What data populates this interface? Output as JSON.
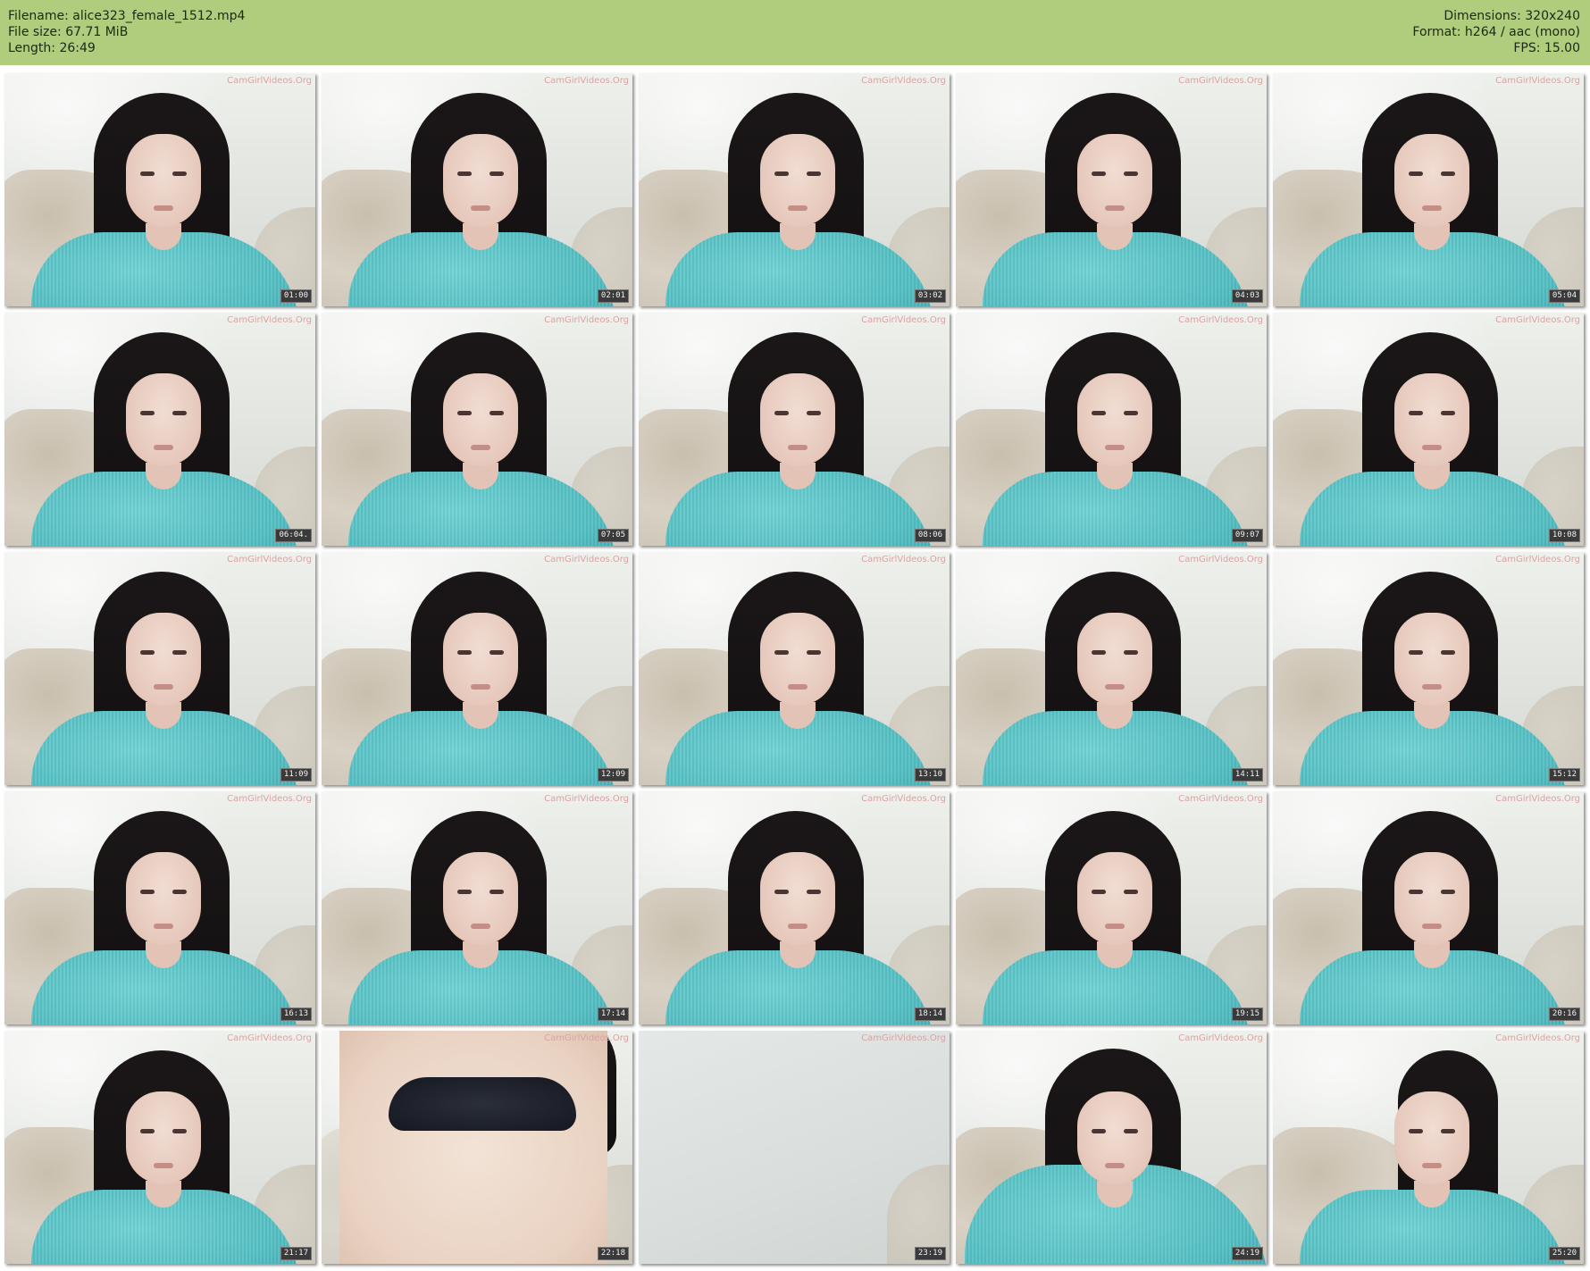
{
  "header": {
    "filename_label": "Filename: alice323_female_1512.mp4",
    "filesize_label": "File size: 67.71 MiB",
    "length_label": "Length: 26:49",
    "dimensions_label": "Dimensions: 320x240",
    "format_label": "Format: h264 / aac (mono)",
    "fps_label": "FPS: 15.00",
    "background_color": "#afcd7c"
  },
  "watermark_text": "CamGirlVideos.Org",
  "thumbnails": [
    {
      "timestamp": "01:00",
      "variant": "default"
    },
    {
      "timestamp": "02:01",
      "variant": "default"
    },
    {
      "timestamp": "03:02",
      "variant": "default"
    },
    {
      "timestamp": "04:03",
      "variant": "default"
    },
    {
      "timestamp": "05:04",
      "variant": "default"
    },
    {
      "timestamp": "06:04.",
      "variant": "default"
    },
    {
      "timestamp": "07:05",
      "variant": "default"
    },
    {
      "timestamp": "08:06",
      "variant": "default"
    },
    {
      "timestamp": "09:07",
      "variant": "default"
    },
    {
      "timestamp": "10:08",
      "variant": "default"
    },
    {
      "timestamp": "11:09",
      "variant": "default"
    },
    {
      "timestamp": "12:09",
      "variant": "default"
    },
    {
      "timestamp": "13:10",
      "variant": "default"
    },
    {
      "timestamp": "14:11",
      "variant": "default"
    },
    {
      "timestamp": "15:12",
      "variant": "default"
    },
    {
      "timestamp": "16:13",
      "variant": "default"
    },
    {
      "timestamp": "17:14",
      "variant": "default"
    },
    {
      "timestamp": "18:14",
      "variant": "default"
    },
    {
      "timestamp": "19:15",
      "variant": "default"
    },
    {
      "timestamp": "20:16",
      "variant": "default"
    },
    {
      "timestamp": "21:17",
      "variant": "default"
    },
    {
      "timestamp": "22:18",
      "variant": "torso"
    },
    {
      "timestamp": "23:19",
      "variant": "blank"
    },
    {
      "timestamp": "24:19",
      "variant": "arms"
    },
    {
      "timestamp": "25:20",
      "variant": "ponytail"
    }
  ]
}
